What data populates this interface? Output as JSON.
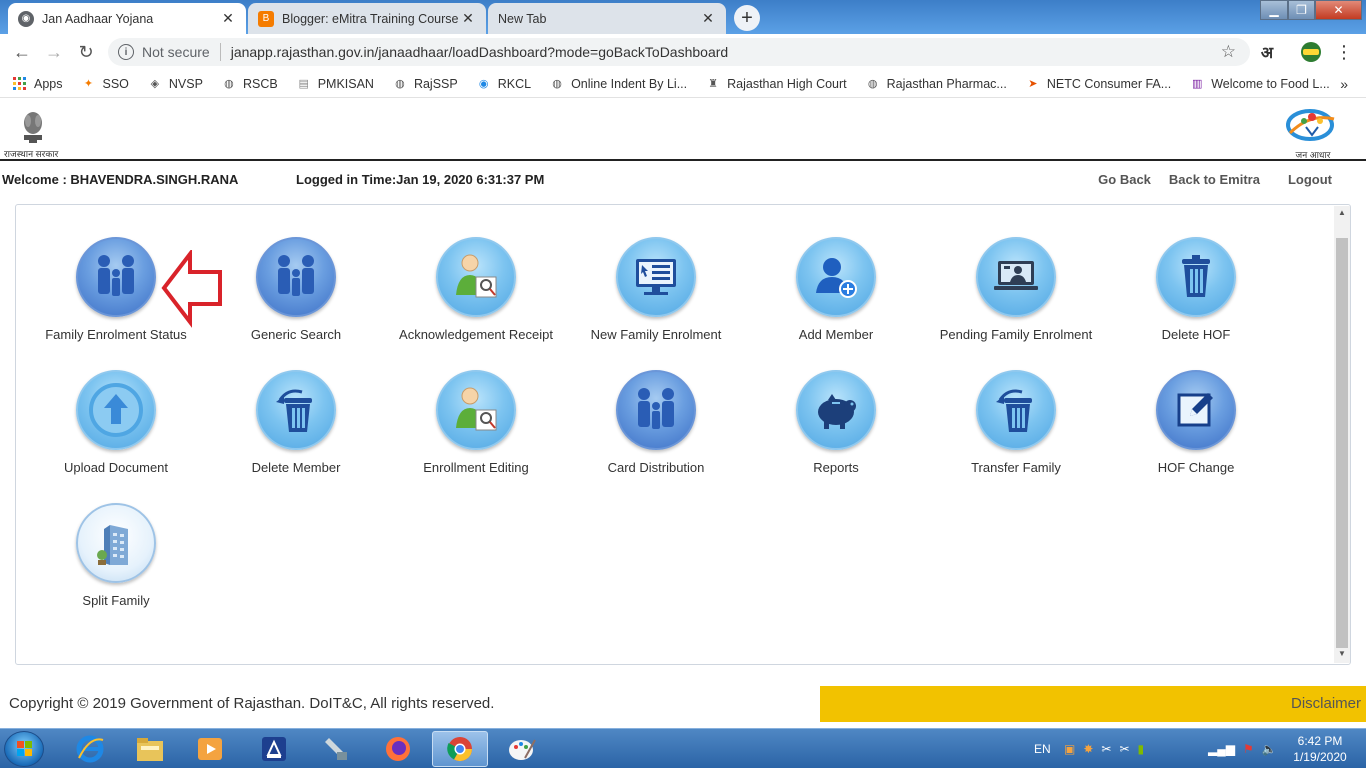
{
  "browser": {
    "tabs": [
      {
        "title": "Jan Aadhaar Yojana",
        "active": true
      },
      {
        "title": "Blogger: eMitra Training Course -",
        "active": false
      },
      {
        "title": "New Tab",
        "active": false
      }
    ],
    "address": {
      "security_label": "Not secure",
      "url": "janapp.rajasthan.gov.in/janaadhaar/loadDashboard?mode=goBackToDashboard"
    },
    "profile_letter": "अ",
    "bookmarks": [
      {
        "label": "Apps",
        "icon": "apps-grid-icon"
      },
      {
        "label": "SSO",
        "icon": "sso-icon"
      },
      {
        "label": "NVSP",
        "icon": "nvsp-icon"
      },
      {
        "label": "RSCB",
        "icon": "globe-icon"
      },
      {
        "label": "PMKISAN",
        "icon": "document-icon"
      },
      {
        "label": "RajSSP",
        "icon": "globe-icon"
      },
      {
        "label": "RKCL",
        "icon": "rkcl-icon"
      },
      {
        "label": "Online Indent By Li...",
        "icon": "globe-icon"
      },
      {
        "label": "Rajasthan High Court",
        "icon": "emblem-icon"
      },
      {
        "label": "Rajasthan Pharmac...",
        "icon": "globe-icon"
      },
      {
        "label": "NETC Consumer FA...",
        "icon": "netc-icon"
      },
      {
        "label": "Welcome to Food L...",
        "icon": "chart-icon"
      }
    ]
  },
  "header": {
    "gov_label": "राजस्थान सरकार",
    "logo_label": "जन आधार"
  },
  "session": {
    "welcome": "Welcome : BHAVENDRA.SINGH.RANA",
    "logged_in": "Logged in Time:Jan 19, 2020 6:31:37 PM",
    "links": [
      "Go Back",
      "Back to Emitra",
      "Logout"
    ]
  },
  "tiles": [
    {
      "label": "Family Enrolment Status",
      "icon": "family-icon"
    },
    {
      "label": "Generic Search",
      "icon": "family-icon"
    },
    {
      "label": "Acknowledgement Receipt",
      "icon": "person-document-icon"
    },
    {
      "label": "New Family Enrolment",
      "icon": "monitor-form-icon"
    },
    {
      "label": "Add Member",
      "icon": "add-user-icon"
    },
    {
      "label": "Pending Family Enrolment",
      "icon": "laptop-user-icon"
    },
    {
      "label": "Delete HOF",
      "icon": "recycle-bin-icon"
    },
    {
      "label": "Upload Document",
      "icon": "upload-arrow-icon"
    },
    {
      "label": "Delete Member",
      "icon": "recycle-bin-icon"
    },
    {
      "label": "Enrollment Editing",
      "icon": "person-document-icon"
    },
    {
      "label": "Card Distribution",
      "icon": "family-icon"
    },
    {
      "label": "Reports",
      "icon": "piggy-bank-icon"
    },
    {
      "label": "Transfer Family",
      "icon": "recycle-bin-icon"
    },
    {
      "label": "HOF Change",
      "icon": "edit-icon"
    },
    {
      "label": "Split Family",
      "icon": "building-icon"
    }
  ],
  "footer": {
    "copyright": "Copyright © 2019 Government of Rajasthan. DoIT&C, All rights reserved.",
    "disclaimer": "Disclaimer"
  },
  "taskbar": {
    "language": "EN",
    "time": "6:42 PM",
    "date": "1/19/2020"
  },
  "colors": {
    "tile_blue": "#4fa6e3",
    "footer_bar": "#f2c200",
    "arrow_red": "#d9232a"
  }
}
